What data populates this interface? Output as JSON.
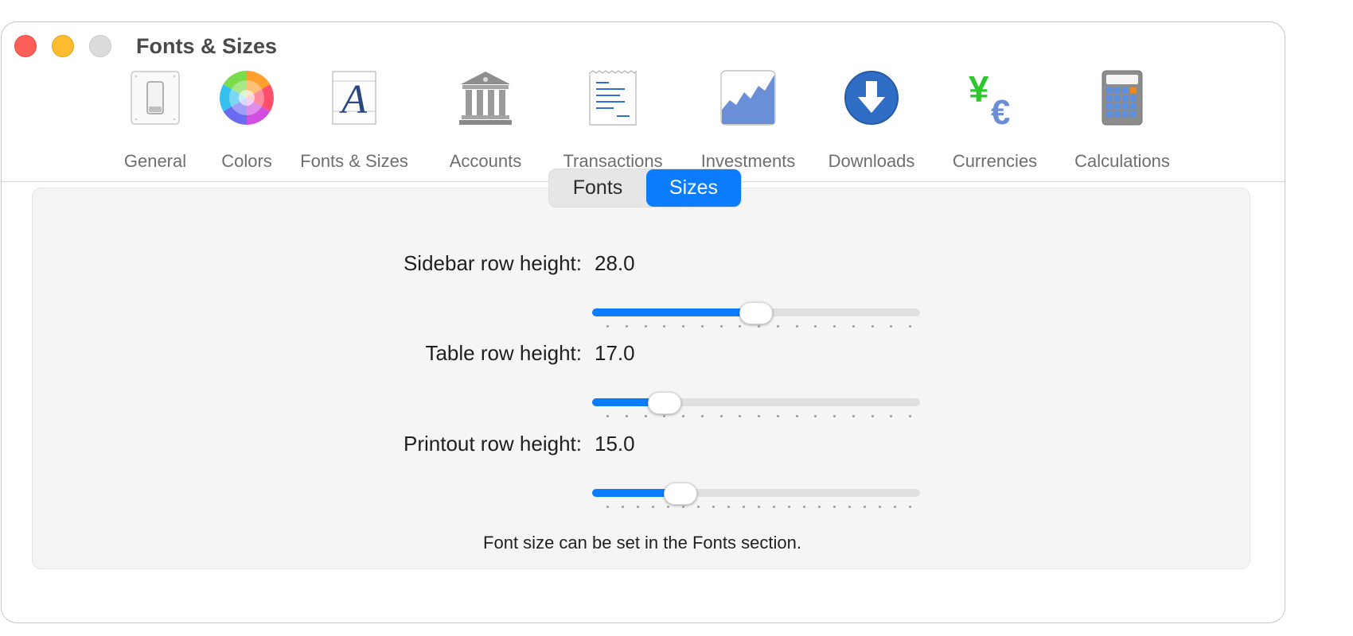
{
  "window": {
    "title": "Fonts & Sizes"
  },
  "toolbar": {
    "items": [
      {
        "label": "General",
        "icon": "general-switch-icon"
      },
      {
        "label": "Colors",
        "icon": "color-wheel-icon"
      },
      {
        "label": "Fonts & Sizes",
        "icon": "font-letter-icon"
      },
      {
        "label": "Accounts",
        "icon": "bank-icon"
      },
      {
        "label": "Transactions",
        "icon": "receipt-icon"
      },
      {
        "label": "Investments",
        "icon": "chart-icon"
      },
      {
        "label": "Downloads",
        "icon": "download-arrow-icon"
      },
      {
        "label": "Currencies",
        "icon": "currency-symbols-icon"
      },
      {
        "label": "Calculations",
        "icon": "calculator-icon"
      }
    ]
  },
  "segmented": {
    "options": [
      "Fonts",
      "Sizes"
    ],
    "selected": "Sizes"
  },
  "sliders": [
    {
      "label": "Sidebar row height:",
      "value": "28.0",
      "fraction": 0.5
    },
    {
      "label": "Table row height:",
      "value": "17.0",
      "fraction": 0.22
    },
    {
      "label": "Printout row height:",
      "value": "15.0",
      "fraction": 0.27
    }
  ],
  "footnote": "Font size can be set in the Fonts section.",
  "colors": {
    "accent": "#0a7cfd",
    "close": "#fe5f57",
    "minimize": "#febc2e",
    "zoom": "#dcdcdc"
  }
}
